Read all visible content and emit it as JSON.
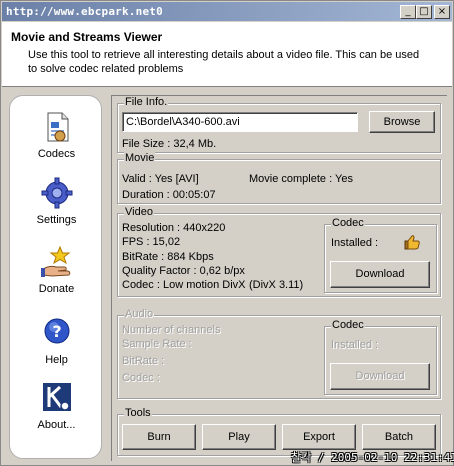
{
  "titlebar": {
    "url": "http://www.ebcpark.net",
    "counter": "0",
    "minimize_glyph": "_",
    "maximize_glyph": "□",
    "close_glyph": "×"
  },
  "header": {
    "title": "Movie and Streams Viewer",
    "description": "Use this tool to retrieve all interesting details about a video file. This can be used to solve codec related problems"
  },
  "sidebar": {
    "items": [
      {
        "label": "Codecs",
        "icon": "document-icon"
      },
      {
        "label": "Settings",
        "icon": "gear-icon"
      },
      {
        "label": "Donate",
        "icon": "hand-star-icon"
      },
      {
        "label": "Help",
        "icon": "help-icon"
      },
      {
        "label": "About...",
        "icon": "k-logo-icon"
      }
    ]
  },
  "file_info": {
    "title": "File Info.",
    "path": "C:\\Bordel\\A340-600.avi",
    "browse_label": "Browse",
    "file_size": "File Size : 32,4 Mb."
  },
  "movie": {
    "title": "Movie",
    "valid": "Valid : Yes [AVI]",
    "complete": "Movie complete : Yes",
    "duration": "Duration : 00:05:07"
  },
  "video": {
    "title": "Video",
    "resolution": "Resolution : 440x220",
    "fps": "FPS : 15,02",
    "bitrate": "BitRate : 884 Kbps",
    "quality": "Quality Factor : 0,62 b/px",
    "codec": "Codec : Low motion DivX",
    "codec_version": "(DivX 3.11)",
    "codec_group": {
      "title": "Codec",
      "installed": "Installed :",
      "download_label": "Download"
    }
  },
  "audio": {
    "title": "Audio",
    "channels": "Number of channels",
    "sample_rate": "Sample Rate :",
    "bitrate": "BitRate :",
    "codec": "Codec :",
    "codec_group": {
      "title": "Codec",
      "installed": "Installed :",
      "download_label": "Download"
    }
  },
  "tools": {
    "title": "Tools",
    "buttons": [
      "Burn",
      "Play",
      "Export",
      "Batch"
    ]
  },
  "watermark": "찰칵 / 2005-02-10 22:31:41",
  "colors": {
    "titlebar_start": "#6b80a8",
    "titlebar_end": "#a3b6d4",
    "face": "#d4d0c8",
    "disabled_text": "#a0a0a0"
  }
}
